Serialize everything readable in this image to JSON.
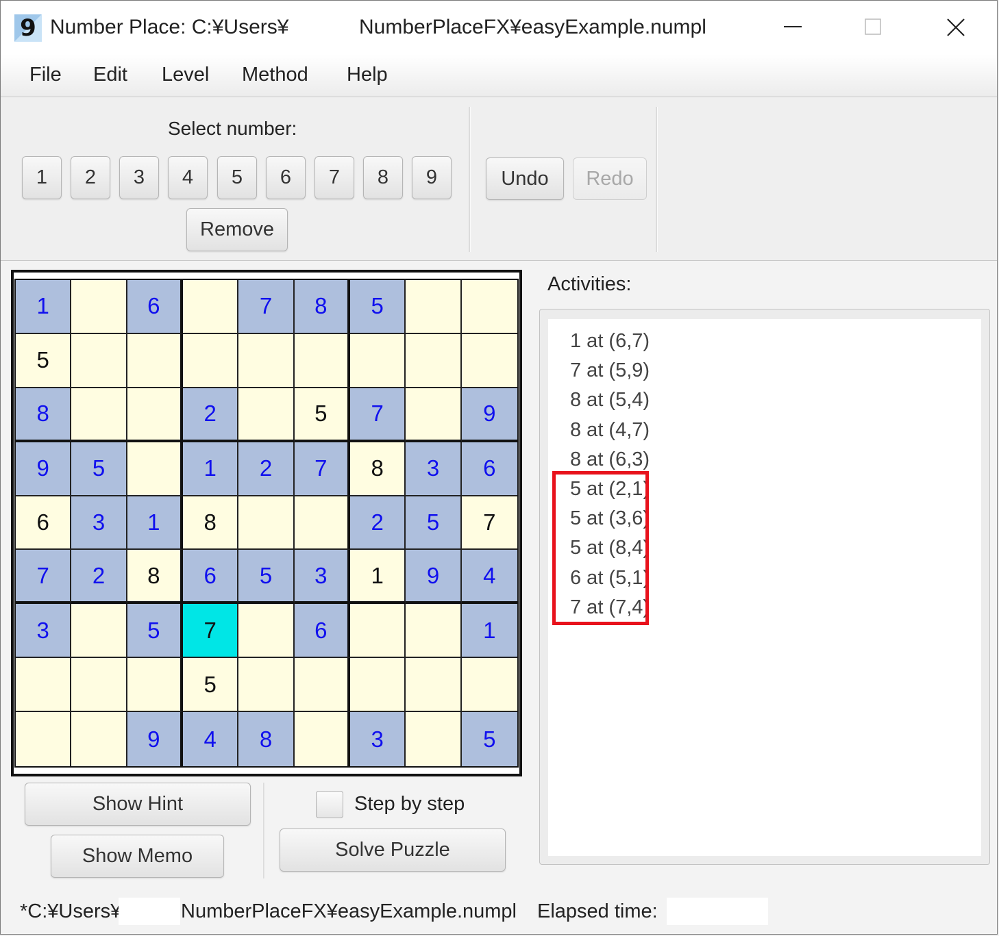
{
  "window": {
    "title_left": "Number Place: C:¥Users¥",
    "title_right": "NumberPlaceFX¥easyExample.numpl",
    "app_icon_glyph": "9",
    "minimize_glyph": "—",
    "maximize_glyph": "☐",
    "close_glyph": "✕"
  },
  "menu": [
    "File",
    "Edit",
    "Level",
    "Method",
    "Help"
  ],
  "toolbar": {
    "select_label": "Select number:",
    "numbers": [
      "1",
      "2",
      "3",
      "4",
      "5",
      "6",
      "7",
      "8",
      "9"
    ],
    "remove_label": "Remove",
    "undo_label": "Undo",
    "redo_label": "Redo"
  },
  "board": {
    "rows": [
      [
        "1",
        "",
        "6",
        "",
        "7",
        "8",
        "5",
        "",
        ""
      ],
      [
        "5",
        "",
        "",
        "",
        "",
        "",
        "",
        "",
        ""
      ],
      [
        "8",
        "",
        "",
        "2",
        "",
        "5",
        "7",
        "",
        "9"
      ],
      [
        "9",
        "5",
        "",
        "1",
        "2",
        "7",
        "8",
        "3",
        "6"
      ],
      [
        "6",
        "3",
        "1",
        "8",
        "",
        "",
        "2",
        "5",
        "7"
      ],
      [
        "7",
        "2",
        "8",
        "6",
        "5",
        "3",
        "1",
        "9",
        "4"
      ],
      [
        "3",
        "",
        "5",
        "7",
        "",
        "6",
        "",
        "",
        "1"
      ],
      [
        "",
        "",
        "",
        "5",
        "",
        "",
        "",
        "",
        ""
      ],
      [
        "",
        "",
        "9",
        "4",
        "8",
        "",
        "3",
        "",
        "5"
      ]
    ],
    "given": [
      [
        1,
        0,
        1,
        0,
        1,
        1,
        1,
        0,
        0
      ],
      [
        0,
        0,
        0,
        0,
        0,
        0,
        0,
        0,
        0
      ],
      [
        1,
        0,
        0,
        1,
        0,
        0,
        1,
        0,
        1
      ],
      [
        1,
        1,
        0,
        1,
        1,
        1,
        0,
        1,
        1
      ],
      [
        0,
        1,
        1,
        0,
        0,
        0,
        1,
        1,
        0
      ],
      [
        1,
        1,
        0,
        1,
        1,
        1,
        0,
        1,
        1
      ],
      [
        1,
        0,
        1,
        0,
        0,
        1,
        0,
        0,
        1
      ],
      [
        0,
        0,
        0,
        0,
        0,
        0,
        0,
        0,
        0
      ],
      [
        0,
        0,
        1,
        1,
        1,
        0,
        1,
        0,
        1
      ]
    ],
    "selected": [
      6,
      3
    ],
    "colors": {
      "given_bg": "#aebfdd",
      "given_text": "#1010ee",
      "empty_bg": "#fffde1",
      "selected_bg": "#00e6e6",
      "user_text": "#111111"
    }
  },
  "activities": {
    "label": "Activities:",
    "items": [
      "1 at (6,7)",
      "7 at (5,9)",
      "8 at (5,4)",
      "8 at (4,7)",
      "8 at (6,3)",
      "5 at (2,1)",
      "5 at (3,6)",
      "5 at (8,4)",
      "6 at (5,1)",
      "7 at (7,4)"
    ],
    "highlight_color": "#e8121c"
  },
  "controls": {
    "show_hint": "Show Hint",
    "show_memo": "Show Memo",
    "step_by_step": "Step by step",
    "step_checked": false,
    "solve_puzzle": "Solve Puzzle"
  },
  "status": {
    "file_left": "*C:¥Users¥",
    "file_right": "NumberPlaceFX¥easyExample.numpl",
    "elapsed_label": "Elapsed time:"
  }
}
